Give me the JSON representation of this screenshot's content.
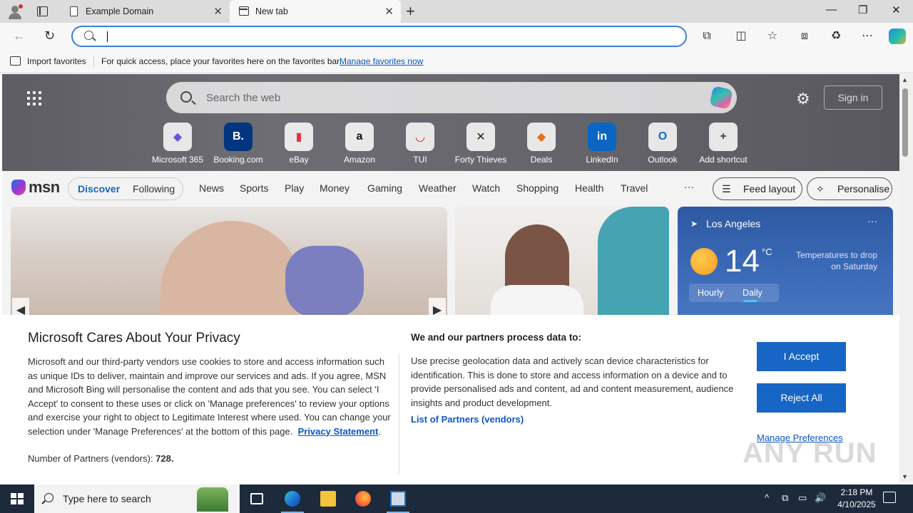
{
  "browser": {
    "tabs": [
      {
        "title": "Example Domain",
        "active": false
      },
      {
        "title": "New tab",
        "active": true
      }
    ],
    "address": {
      "value": "",
      "placeholder": ""
    },
    "favorites_bar": {
      "import_label": "Import favorites",
      "hint": "For quick access, place your favorites here on the favorites bar.",
      "manage_link": "Manage favorites now"
    },
    "icons": {
      "back": "←",
      "refresh": "↻",
      "minimize": "—",
      "restore": "❐",
      "close": "✕",
      "close_tab": "✕",
      "new_tab": "+",
      "extensions": "⧉",
      "split": "◫",
      "favorite": "☆",
      "collections": "⧈",
      "performance": "♻",
      "more": "⋯"
    }
  },
  "ntp": {
    "search_placeholder": "Search the web",
    "sign_in": "Sign in",
    "gear_icon": "⚙",
    "shortcuts": [
      {
        "label": "Microsoft 365",
        "glyph": "◆",
        "color": "#6b52d6"
      },
      {
        "label": "Booking.com",
        "glyph": "B.",
        "color": "#ffffff",
        "bg": "#003580"
      },
      {
        "label": "eBay",
        "glyph": "▮",
        "color": "#e53238"
      },
      {
        "label": "Amazon",
        "glyph": "a",
        "color": "#111111"
      },
      {
        "label": "TUI",
        "glyph": "◡",
        "color": "#d40e14"
      },
      {
        "label": "Forty Thieves",
        "glyph": "✕",
        "color": "#222222"
      },
      {
        "label": "Deals",
        "glyph": "◆",
        "color": "#e8701a"
      },
      {
        "label": "LinkedIn",
        "glyph": "in",
        "color": "#ffffff",
        "bg": "#0a66c2"
      },
      {
        "label": "Outlook",
        "glyph": "O",
        "color": "#0f6cbd"
      },
      {
        "label": "Add shortcut",
        "glyph": "+",
        "color": "#444444"
      }
    ],
    "msn": {
      "logo": "msn",
      "discover": "Discover",
      "following": "Following",
      "nav": [
        "News",
        "Sports",
        "Play",
        "Money",
        "Gaming",
        "Weather",
        "Watch",
        "Shopping",
        "Health",
        "Travel"
      ],
      "more": "···",
      "feed_layout": "Feed layout",
      "personalise": "Personalise"
    },
    "weather": {
      "location": "Los Angeles",
      "temperature": "14",
      "unit": "°C",
      "note": "Temperatures to drop on Saturday",
      "tabs": [
        "Hourly",
        "Daily"
      ],
      "selected_tab": "Daily"
    }
  },
  "privacy": {
    "title": "Microsoft Cares About Your Privacy",
    "body": "Microsoft and our third-party vendors use cookies to store and access information such as unique IDs to deliver, maintain and improve our services and ads. If you agree, MSN and Microsoft Bing will personalise the content and ads that you see. You can select 'I Accept' to consent to these uses or click on 'Manage preferences' to review your options and exercise your right to object to Legitimate Interest where used.  You can change your selection under 'Manage Preferences' at the bottom of this page.",
    "privacy_link": "Privacy Statement",
    "partners_label": "Number of Partners (vendors):",
    "partners_count": "728.",
    "right_title": "We and our partners process data to:",
    "right_body": "Use precise geolocation data and actively scan device characteristics for identification. This is done to store and access information on a device and to provide personalised ads and content, ad and content measurement, audience insights and product development.",
    "vendors_link": "List of Partners (vendors)",
    "accept": "I Accept",
    "reject": "Reject All",
    "manage": "Manage Preferences"
  },
  "watermark": "ANY RUN",
  "taskbar": {
    "search_placeholder": "Type here to search",
    "time": "2:18 PM",
    "date": "4/10/2025",
    "tray_icons": [
      "^",
      "⧉",
      "▭",
      "🔊"
    ]
  },
  "colors": {
    "accent": "#1765c4",
    "taskbar": "#1c2a3c",
    "hero": "#66656b"
  }
}
